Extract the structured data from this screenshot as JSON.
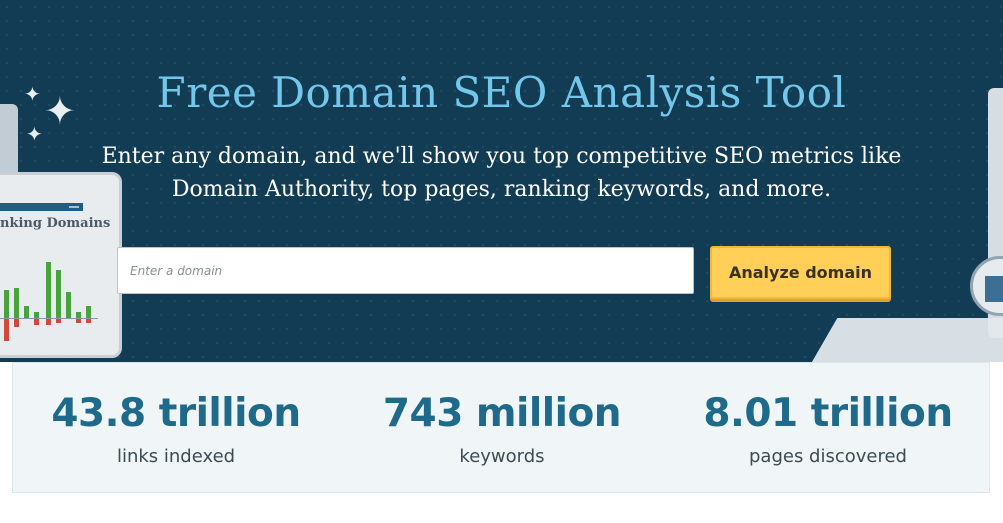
{
  "hero": {
    "title": "Free Domain SEO Analysis Tool",
    "subtitle_line1": "Enter any domain, and we'll show you top competitive SEO metrics like",
    "subtitle_line2": "Domain Authority, top pages, ranking keywords, and more."
  },
  "search": {
    "placeholder": "Enter a domain",
    "value": "",
    "button_label": "Analyze domain"
  },
  "decoration": {
    "card_title": "nking Domains",
    "icons": [
      "sparkle-icon",
      "bar-chart-icon"
    ]
  },
  "stats": [
    {
      "value": "43.8 trillion",
      "label": "links indexed"
    },
    {
      "value": "743 million",
      "label": "keywords"
    },
    {
      "value": "8.01 trillion",
      "label": "pages discovered"
    }
  ],
  "colors": {
    "hero_background": "#123b54",
    "title": "#72c7ea",
    "button": "#ffcf57",
    "stat_value": "#1f6a8a",
    "stats_background": "#f0f6f7"
  }
}
